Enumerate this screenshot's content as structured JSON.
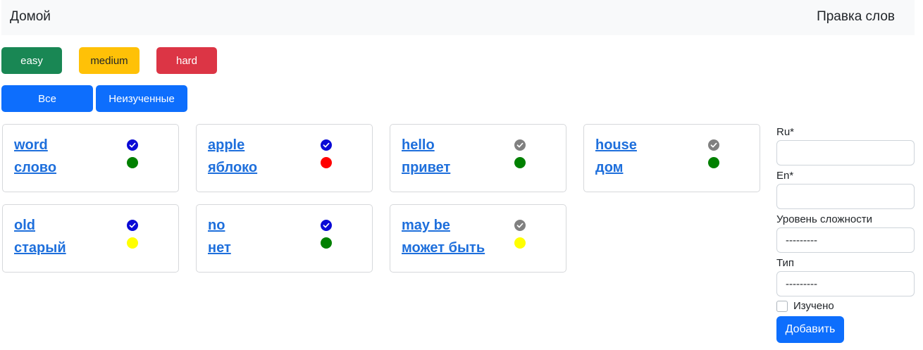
{
  "navbar": {
    "home": "Домой",
    "edit": "Правка слов"
  },
  "difficulty_filters": {
    "easy": "easy",
    "medium": "medium",
    "hard": "hard"
  },
  "learned_filters": {
    "all": "Все",
    "unlearned": "Неизученные"
  },
  "colors": {
    "checked": "#0a0ad6",
    "unchecked": "#808080",
    "easy_dot": "#008000",
    "medium_dot": "#ffff00",
    "hard_dot": "#ff0000"
  },
  "words": [
    {
      "en": "word",
      "ru": "слово",
      "learned": true,
      "level": "easy"
    },
    {
      "en": "apple",
      "ru": "яблоко",
      "learned": true,
      "level": "hard"
    },
    {
      "en": "hello",
      "ru": "привет",
      "learned": false,
      "level": "easy"
    },
    {
      "en": "house",
      "ru": "дом",
      "learned": false,
      "level": "easy"
    },
    {
      "en": "old",
      "ru": "старый",
      "learned": true,
      "level": "medium"
    },
    {
      "en": "no",
      "ru": "нет",
      "learned": true,
      "level": "easy"
    },
    {
      "en": "may be",
      "ru": "может быть",
      "learned": false,
      "level": "medium"
    }
  ],
  "form": {
    "ru_label": "Ru*",
    "en_label": "En*",
    "ru_value": "",
    "en_value": "",
    "level_label": "Уровень сложности",
    "level_value": "---------",
    "type_label": "Тип",
    "type_value": "---------",
    "learned_label": "Изучено",
    "learned_checked": false,
    "submit_label": "Добавить"
  }
}
